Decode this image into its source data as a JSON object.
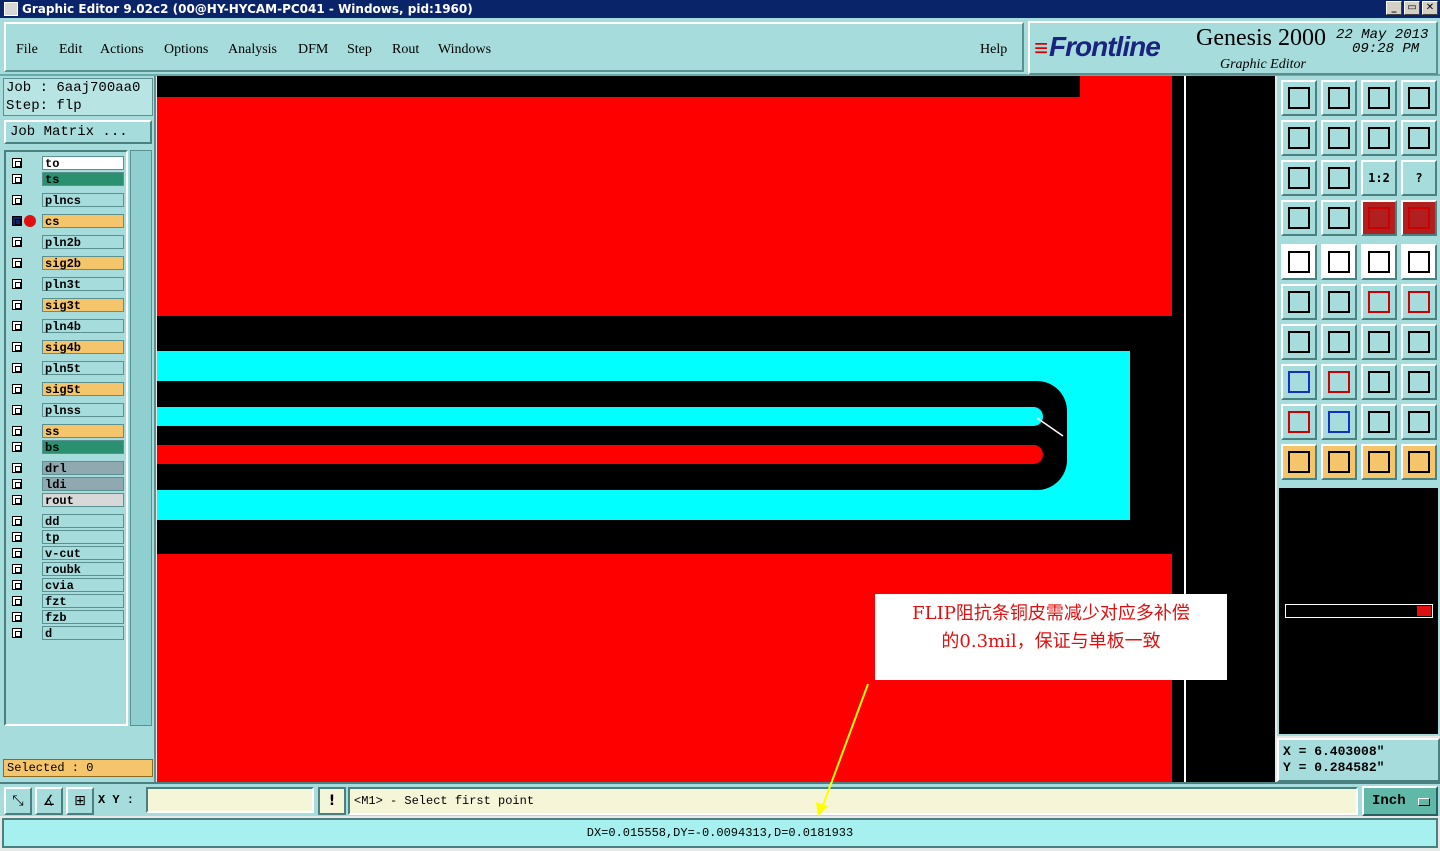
{
  "window": {
    "title": "Graphic Editor 9.02c2 (00@HY-HYCAM-PC041 - Windows, pid:1960)",
    "buttons": [
      "_",
      "▭",
      "✕"
    ]
  },
  "menu": {
    "items": [
      "File",
      "Edit",
      "Actions",
      "Options",
      "Analysis",
      "DFM",
      "Step",
      "Rout",
      "Windows"
    ],
    "help": "Help"
  },
  "brand": {
    "logo": "Frontline",
    "title": "Genesis 2000",
    "date": "22 May 2013",
    "time": "09:28 PM",
    "subtitle": "Graphic Editor"
  },
  "job": {
    "job_line": "Job : 6aaj700aa0",
    "step_line": "Step: flp",
    "matrix_button": "Job Matrix ..."
  },
  "layers": [
    {
      "name": "to",
      "color": "#ffffff"
    },
    {
      "name": "ts",
      "color": "#2a9070"
    },
    {
      "name": "plncs",
      "color": "#a6dcdc"
    },
    {
      "name": "cs",
      "color": "#f5c56b",
      "active": true
    },
    {
      "name": "pln2b",
      "color": "#a6dcdc"
    },
    {
      "name": "sig2b",
      "color": "#f5c56b"
    },
    {
      "name": "pln3t",
      "color": "#a6dcdc"
    },
    {
      "name": "sig3t",
      "color": "#f5c56b"
    },
    {
      "name": "pln4b",
      "color": "#a6dcdc"
    },
    {
      "name": "sig4b",
      "color": "#f5c56b"
    },
    {
      "name": "pln5t",
      "color": "#a6dcdc"
    },
    {
      "name": "sig5t",
      "color": "#f5c56b"
    },
    {
      "name": "plnss",
      "color": "#a6dcdc"
    },
    {
      "name": "ss",
      "color": "#f5c56b"
    },
    {
      "name": "bs",
      "color": "#2a9070"
    },
    {
      "name": "drl",
      "color": "#90a8b0"
    },
    {
      "name": "ldi",
      "color": "#90a8b0"
    },
    {
      "name": "rout",
      "color": "#d8d8d8"
    },
    {
      "name": "dd",
      "color": "#a6dcdc"
    },
    {
      "name": "tp",
      "color": "#a6dcdc"
    },
    {
      "name": "v-cut",
      "color": "#a6dcdc"
    },
    {
      "name": "roubk",
      "color": "#a6dcdc"
    },
    {
      "name": "cvia",
      "color": "#a6dcdc"
    },
    {
      "name": "fzt",
      "color": "#a6dcdc"
    },
    {
      "name": "fzb",
      "color": "#a6dcdc"
    },
    {
      "name": "d",
      "color": "#a6dcdc"
    }
  ],
  "selected": "Selected : 0",
  "coords": {
    "x": "X = 6.403008\"",
    "y": "Y = 0.284582\""
  },
  "toolbar": {
    "icons": [
      "zoom-home-icon",
      "zoom-down-icon",
      "home-icon",
      "window-icon",
      "pan-left-icon",
      "pan-right-icon",
      "swap-icon",
      "snap-icon",
      "fit-icon",
      "center-icon",
      "ratio-icon",
      "help-icon",
      "tools-icon",
      "grid-icon",
      "pcb-red-icon",
      "pcb-red2-icon",
      "select-pad-icon",
      "shape-icon",
      "measure-icon",
      "dot-icon",
      "net-icon",
      "cross-icon",
      "point-red-icon",
      "point-red2-icon",
      "angle-icon",
      "line-icon",
      "rotate-icon",
      "mirror-icon",
      "pad-blue-icon",
      "line-red-icon",
      "frame-icon",
      "blob-icon",
      "tri-red-icon",
      "tri-blue-icon",
      "tri-mix-icon",
      "tri-mix2-icon",
      "arrow-icon",
      "arrow-box-icon",
      "arrow-box2-icon",
      "route-icon"
    ],
    "ratio_text": "1:2",
    "help_text": "?"
  },
  "bottom": {
    "xy_label": "X Y :",
    "xy_value": "",
    "bang": "!",
    "prompt": "<M1> - Select first point",
    "units": "Inch",
    "status": "DX=0.015558,DY=-0.0094313,D=0.0181933"
  },
  "annotation": {
    "line1": "FLIP阻抗条铜皮需减少对应多补偿",
    "line2": "的0.3mil，保证与单板一致"
  },
  "colors": {
    "copper_red": "#ff0000",
    "cyan_layer": "#00ffff",
    "panel": "#a6dcdc",
    "annotation_arrow": "#ffff00"
  }
}
